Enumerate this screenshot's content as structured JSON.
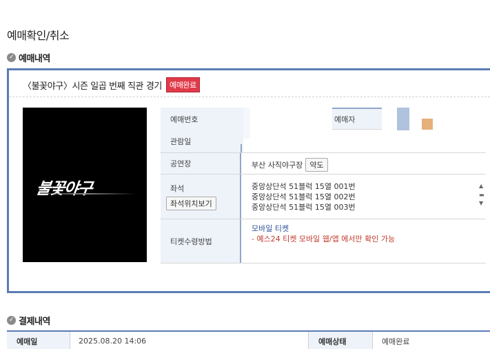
{
  "page": {
    "title": "예매확인/취소"
  },
  "reservation_section": {
    "heading": "예매내역"
  },
  "event": {
    "title": "〈불꽃야구〉시즌 일곱 번째 직관 경기",
    "status_badge": "예매완료",
    "poster_logo_text": "불꽃야구"
  },
  "details": {
    "reservation_no_label": "예매번호",
    "booker_label": "예매자",
    "date_label": "관람일",
    "venue_label": "공연장",
    "venue_value": "부산 사직야구장",
    "map_button": "약도",
    "seat_label": "좌석",
    "seat_view_button": "좌석위치보기",
    "seats": [
      "중앙상단석 51블럭 15열 001번",
      "중앙상단석 51블럭 15열 002번",
      "중앙상단석 51블럭 15열 003번"
    ],
    "ticket_method_label": "티켓수령방법",
    "ticket_method_value": "모바일 티켓",
    "ticket_method_note": "- 예스24 티켓 모바일 웹/앱 에서만 확인 가능"
  },
  "payment_section": {
    "heading": "결제내역",
    "date_label": "예매일",
    "date_value": "2025.08.20 14:06",
    "status_label": "예매상태",
    "status_value": "예매완료"
  },
  "colors": {
    "accent_border": "#5a7bb5",
    "badge_red": "#e03a4a",
    "label_bg": "#eef3fa"
  },
  "icons": {
    "section_check": "check-circle-icon",
    "scroll_up": "triangle-up-icon",
    "scroll_down": "triangle-down-icon"
  }
}
